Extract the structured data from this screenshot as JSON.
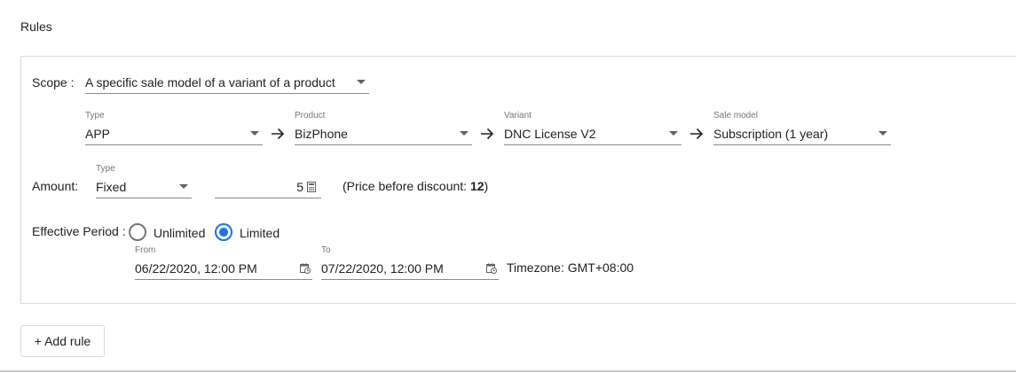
{
  "section": {
    "title": "Rules"
  },
  "scope": {
    "label": "Scope :",
    "value": "A specific sale model of a variant of a product"
  },
  "target": {
    "type": {
      "caption": "Type",
      "value": "APP"
    },
    "product": {
      "caption": "Product",
      "value": "BizPhone"
    },
    "variant": {
      "caption": "Variant",
      "value": "DNC License V2"
    },
    "sale_model": {
      "caption": "Sale model",
      "value": "Subscription (1 year)"
    }
  },
  "amount": {
    "label": "Amount:",
    "type_caption": "Type",
    "type_value": "Fixed",
    "value": "5",
    "price_prefix": "(Price before discount: ",
    "price_value": "12",
    "price_suffix": ")"
  },
  "effective_period": {
    "label": "Effective Period :",
    "options": [
      {
        "label": "Unlimited",
        "checked": false
      },
      {
        "label": "Limited",
        "checked": true
      }
    ],
    "from": {
      "caption": "From",
      "value": "06/22/2020, 12:00 PM"
    },
    "to": {
      "caption": "To",
      "value": "07/22/2020, 12:00 PM"
    },
    "timezone": "Timezone: GMT+08:00"
  },
  "actions": {
    "add_rule": "+ Add rule"
  },
  "colors": {
    "accent": "#1a73e8",
    "border": "#dadada"
  },
  "icons": {
    "dropdown": "caret-down-icon",
    "arrow": "arrow-right-icon",
    "calculator": "calculator-icon",
    "calendar": "calendar-clock-icon"
  }
}
